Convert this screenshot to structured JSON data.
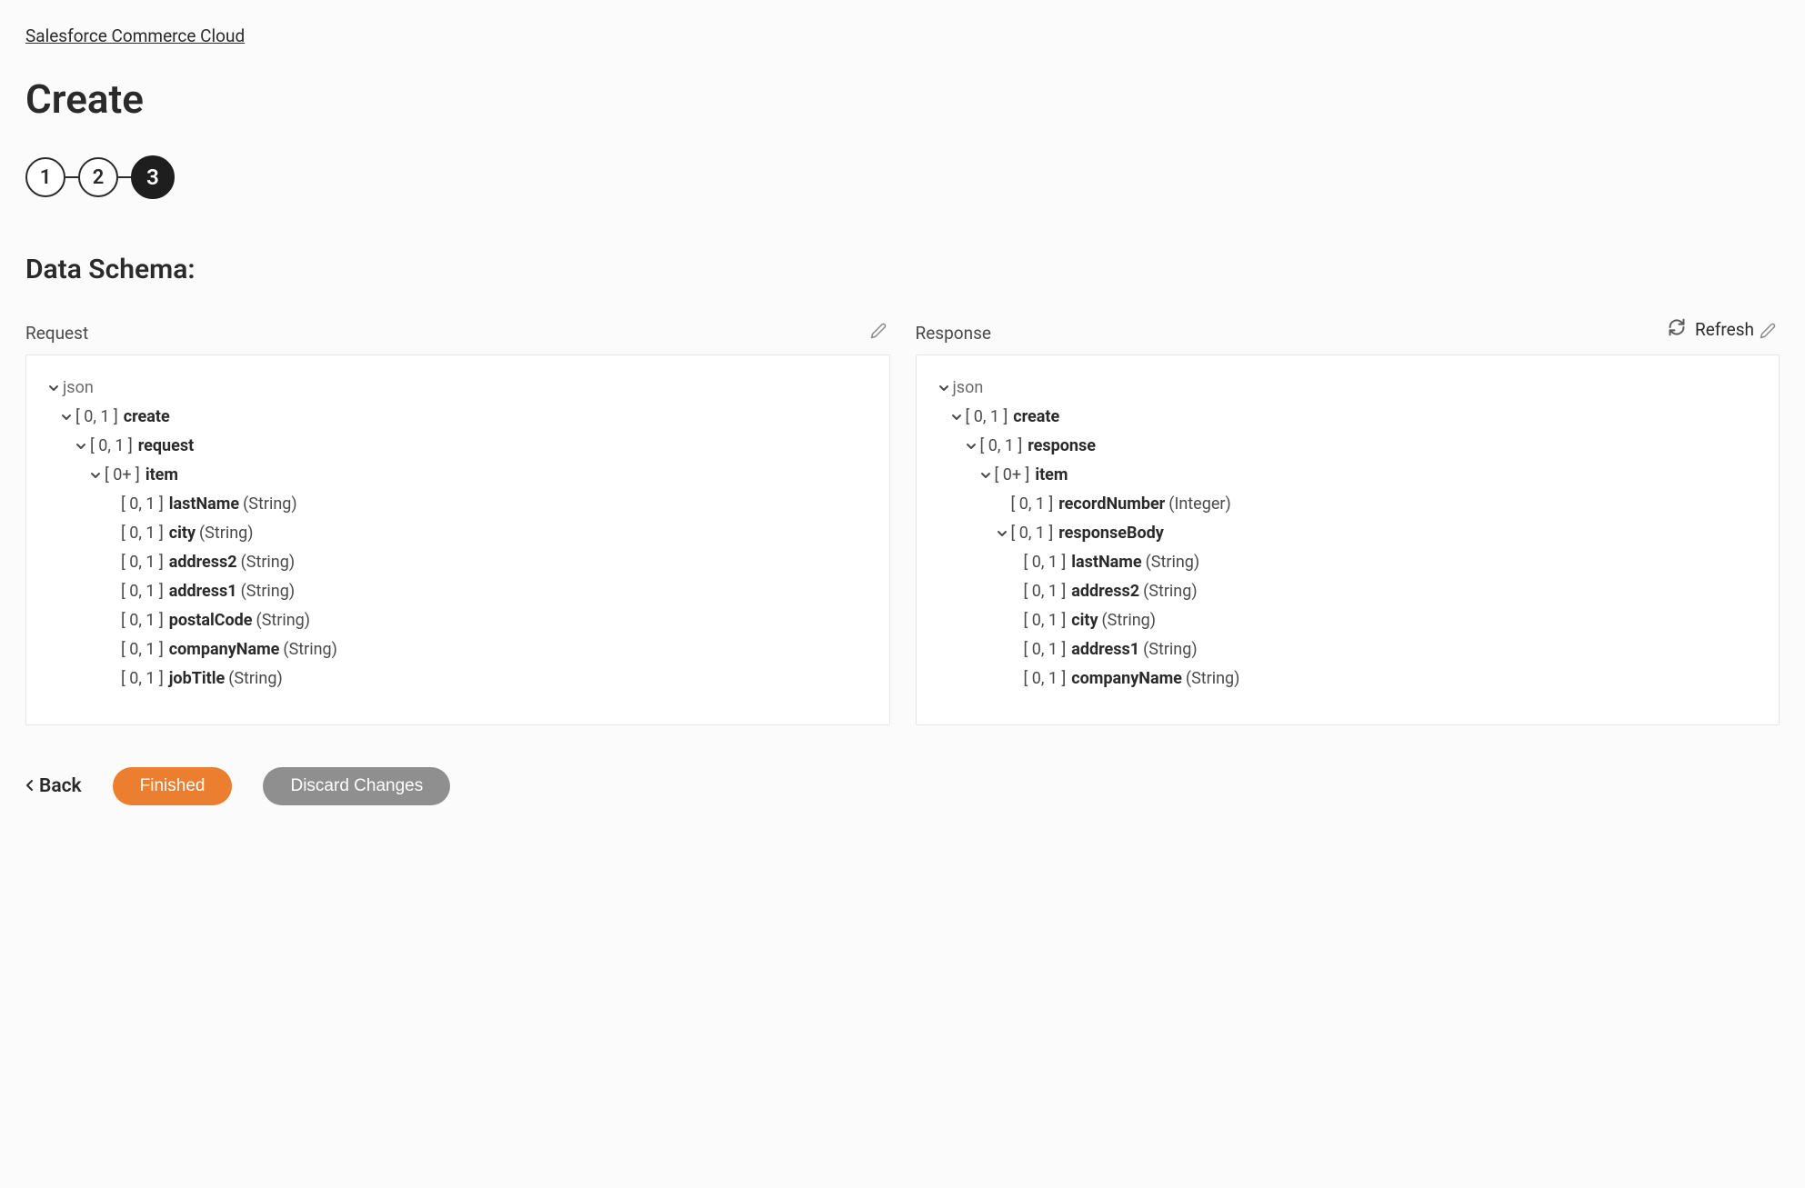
{
  "breadcrumb": "Salesforce Commerce Cloud",
  "pageTitle": "Create",
  "stepper": {
    "steps": [
      "1",
      "2",
      "3"
    ],
    "activeIndex": 2
  },
  "sectionTitle": "Data Schema:",
  "refreshLabel": "Refresh",
  "panels": {
    "request": {
      "label": "Request",
      "root": "json",
      "tree": [
        {
          "caret": true,
          "indent": 1,
          "card": "[ 0, 1 ]",
          "name": "create"
        },
        {
          "caret": true,
          "indent": 2,
          "card": "[ 0, 1 ]",
          "name": "request"
        },
        {
          "caret": true,
          "indent": 3,
          "card": "[ 0+ ]",
          "name": "item"
        },
        {
          "caret": false,
          "indent": 4,
          "card": "[ 0, 1 ]",
          "name": "lastName",
          "type": "(String)"
        },
        {
          "caret": false,
          "indent": 4,
          "card": "[ 0, 1 ]",
          "name": "city",
          "type": "(String)"
        },
        {
          "caret": false,
          "indent": 4,
          "card": "[ 0, 1 ]",
          "name": "address2",
          "type": "(String)"
        },
        {
          "caret": false,
          "indent": 4,
          "card": "[ 0, 1 ]",
          "name": "address1",
          "type": "(String)"
        },
        {
          "caret": false,
          "indent": 4,
          "card": "[ 0, 1 ]",
          "name": "postalCode",
          "type": "(String)"
        },
        {
          "caret": false,
          "indent": 4,
          "card": "[ 0, 1 ]",
          "name": "companyName",
          "type": "(String)"
        },
        {
          "caret": false,
          "indent": 4,
          "card": "[ 0, 1 ]",
          "name": "jobTitle",
          "type": "(String)"
        }
      ]
    },
    "response": {
      "label": "Response",
      "root": "json",
      "tree": [
        {
          "caret": true,
          "indent": 1,
          "card": "[ 0, 1 ]",
          "name": "create"
        },
        {
          "caret": true,
          "indent": 2,
          "card": "[ 0, 1 ]",
          "name": "response"
        },
        {
          "caret": true,
          "indent": 3,
          "card": "[ 0+ ]",
          "name": "item"
        },
        {
          "caret": false,
          "indent": 4,
          "card": "[ 0, 1 ]",
          "name": "recordNumber",
          "type": "(Integer)"
        },
        {
          "caret": true,
          "indent": 4,
          "card": "[ 0, 1 ]",
          "name": "responseBody"
        },
        {
          "caret": false,
          "indent": 5,
          "card": "[ 0, 1 ]",
          "name": "lastName",
          "type": "(String)"
        },
        {
          "caret": false,
          "indent": 5,
          "card": "[ 0, 1 ]",
          "name": "address2",
          "type": "(String)"
        },
        {
          "caret": false,
          "indent": 5,
          "card": "[ 0, 1 ]",
          "name": "city",
          "type": "(String)"
        },
        {
          "caret": false,
          "indent": 5,
          "card": "[ 0, 1 ]",
          "name": "address1",
          "type": "(String)"
        },
        {
          "caret": false,
          "indent": 5,
          "card": "[ 0, 1 ]",
          "name": "companyName",
          "type": "(String)"
        }
      ]
    }
  },
  "footer": {
    "back": "Back",
    "finished": "Finished",
    "discard": "Discard Changes"
  }
}
